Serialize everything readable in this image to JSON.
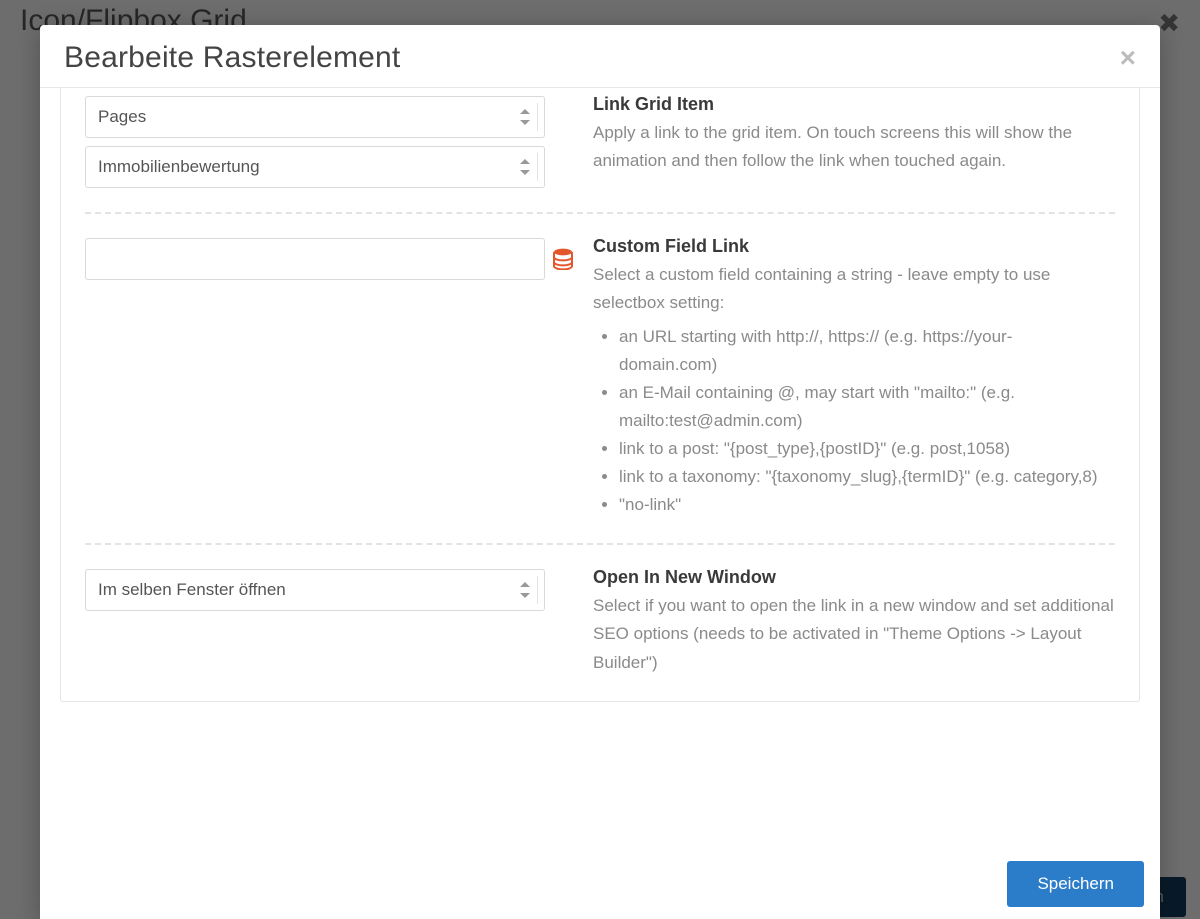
{
  "background": {
    "title": "Icon/Flipbox Grid",
    "save_label": "Speichern"
  },
  "modal": {
    "title": "Bearbeite Rasterelement",
    "save_label": "Speichern"
  },
  "link_grid": {
    "select_type": "Pages",
    "select_page": "Immobilienbewertung",
    "title": "Link Grid Item",
    "desc": "Apply a link to the grid item. On touch screens this will show the animation and then follow the link when touched again."
  },
  "custom_field": {
    "value": "",
    "title": "Custom Field Link",
    "desc": "Select a custom field containing a string - leave empty to use selectbox setting:",
    "bullets": [
      "an URL starting with http://, https:// (e.g. https://your-domain.com)",
      "an E-Mail containing @, may start with \"mailto:\" (e.g. mailto:test@admin.com)",
      "link to a post: \"{post_type},{postID}\" (e.g. post,1058)",
      "link to a taxonomy: \"{taxonomy_slug},{termID}\" (e.g. category,8)",
      "\"no-link\""
    ]
  },
  "new_window": {
    "select": "Im selben Fenster öffnen",
    "title": "Open In New Window",
    "desc": "Select if you want to open the link in a new window and set additional SEO options (needs to be activated in \"Theme Options -> Layout Builder\")"
  }
}
